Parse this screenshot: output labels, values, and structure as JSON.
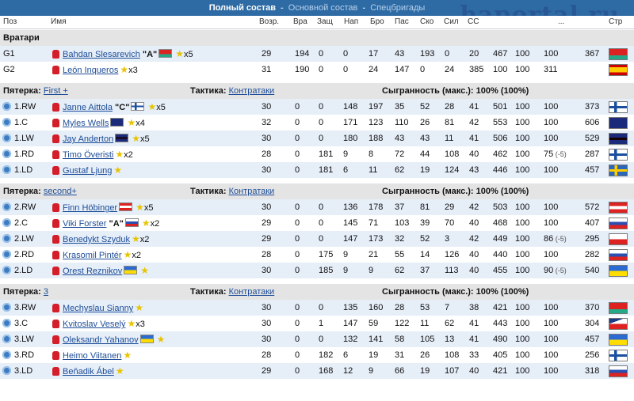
{
  "topbar": {
    "active": "Полный состав",
    "tab2": "Основной состав",
    "tab3": "Спецбригады"
  },
  "watermark": "haportal.ru",
  "header": {
    "pos": "Поз",
    "name": "Имя",
    "age": "Возр.",
    "vra": "Вра",
    "zash": "Защ",
    "nap": "Нап",
    "bro": "Бро",
    "pas": "Пас",
    "sko": "Ско",
    "sil": "Сил",
    "so": "СС",
    "cols_hidden": "...",
    "cr": "Стр"
  },
  "goalies": {
    "title": "Вратари",
    "players": [
      {
        "pos": "G1",
        "name": "Bahdan Slesarevich",
        "tag": "\"A\"",
        "flag": "by",
        "stars": "x5",
        "v": [
          "29",
          "194",
          "0",
          "0",
          "17",
          "43",
          "193",
          "0",
          "20",
          "467",
          "100",
          "100",
          "367"
        ]
      },
      {
        "pos": "G2",
        "name": "León Inqueros",
        "tag": "",
        "flag": "",
        "stars": "x3",
        "v": [
          "31",
          "190",
          "0",
          "0",
          "24",
          "147",
          "0",
          "24",
          "385",
          "100",
          "100",
          "311"
        ],
        "cflag": "es"
      }
    ]
  },
  "lines": [
    {
      "label": "Пятерка:",
      "line_name": "First +",
      "tactic_label": "Тактика:",
      "tactic": "Контратаки",
      "played": "Сыгранность (макс.): 100% (100%)",
      "players": [
        {
          "pos": "1.RW",
          "name": "Janne Aittola",
          "tag": "\"C\"",
          "flag": "fi",
          "stars": "x5",
          "v": [
            "30",
            "0",
            "0",
            "148",
            "197",
            "35",
            "52",
            "28",
            "41",
            "501",
            "100",
            "100",
            "373"
          ],
          "cflag": "fi"
        },
        {
          "pos": "1.C",
          "name": "Myles Wells",
          "tag": "",
          "flag": "au",
          "stars": "x4",
          "v": [
            "32",
            "0",
            "0",
            "171",
            "123",
            "110",
            "26",
            "81",
            "42",
            "553",
            "100",
            "100",
            "606"
          ],
          "cflag": "au"
        },
        {
          "pos": "1.LW",
          "name": "Jay Anderton",
          "tag": "",
          "flag": "gb",
          "stars": "x5",
          "v": [
            "30",
            "0",
            "0",
            "180",
            "188",
            "43",
            "43",
            "11",
            "41",
            "506",
            "100",
            "100",
            "529"
          ],
          "cflag": "gb"
        },
        {
          "pos": "1.RD",
          "name": "Timo Överisti",
          "tag": "",
          "flag": "",
          "stars": "x2",
          "v": [
            "28",
            "0",
            "181",
            "9",
            "8",
            "72",
            "44",
            "108",
            "40",
            "462",
            "100",
            "75",
            "287"
          ],
          "neg": "(-5)",
          "cflag": "fi"
        },
        {
          "pos": "1.LD",
          "name": "Gustaf Ljung",
          "tag": "",
          "flag": "",
          "stars": "",
          "v": [
            "30",
            "0",
            "181",
            "6",
            "11",
            "62",
            "19",
            "124",
            "43",
            "446",
            "100",
            "100",
            "457"
          ],
          "cflag": "se"
        }
      ]
    },
    {
      "label": "Пятерка:",
      "line_name": "second+",
      "tactic_label": "Тактика:",
      "tactic": "Контратаки",
      "played": "Сыгранность (макс.): 100% (100%)",
      "players": [
        {
          "pos": "2.RW",
          "name": "Finn Höbinger",
          "tag": "",
          "flag": "at",
          "stars": "x5",
          "v": [
            "30",
            "0",
            "0",
            "136",
            "178",
            "37",
            "81",
            "29",
            "42",
            "503",
            "100",
            "100",
            "572"
          ],
          "cflag": "at"
        },
        {
          "pos": "2.C",
          "name": "Viki Forster",
          "tag": "\"A\"",
          "flag": "ru",
          "stars": "x2",
          "v": [
            "29",
            "0",
            "0",
            "145",
            "71",
            "103",
            "39",
            "70",
            "40",
            "468",
            "100",
            "100",
            "407"
          ],
          "cflag": "ru"
        },
        {
          "pos": "2.LW",
          "name": "Benedykt Szyduk",
          "tag": "",
          "flag": "",
          "stars": "x2",
          "v": [
            "29",
            "0",
            "0",
            "147",
            "173",
            "32",
            "52",
            "3",
            "42",
            "449",
            "100",
            "86",
            "295"
          ],
          "neg": "(-5)",
          "cflag": "pl"
        },
        {
          "pos": "2.RD",
          "name": "Krasomil Pintér",
          "tag": "",
          "flag": "",
          "stars": "x2",
          "v": [
            "28",
            "0",
            "175",
            "9",
            "21",
            "55",
            "14",
            "126",
            "40",
            "440",
            "100",
            "100",
            "282"
          ],
          "cflag": "sk"
        },
        {
          "pos": "2.LD",
          "name": "Orest Reznikov",
          "tag": "",
          "flag": "ua",
          "stars": "",
          "v": [
            "30",
            "0",
            "185",
            "9",
            "9",
            "62",
            "37",
            "113",
            "40",
            "455",
            "100",
            "90",
            "540"
          ],
          "neg": "(-5)",
          "cflag": "ua"
        }
      ]
    },
    {
      "label": "Пятерка:",
      "line_name": "3",
      "tactic_label": "Тактика:",
      "tactic": "Контратаки",
      "played": "Сыгранность (макс.): 100% (100%)",
      "players": [
        {
          "pos": "3.RW",
          "name": "Mechyslau Sianny",
          "tag": "",
          "flag": "",
          "stars": "",
          "v": [
            "30",
            "0",
            "0",
            "135",
            "160",
            "28",
            "53",
            "7",
            "38",
            "421",
            "100",
            "100",
            "370"
          ],
          "cflag": "by"
        },
        {
          "pos": "3.C",
          "name": "Kvitoslav Veselý",
          "tag": "",
          "flag": "",
          "stars": "x3",
          "v": [
            "30",
            "0",
            "1",
            "147",
            "59",
            "122",
            "11",
            "62",
            "41",
            "443",
            "100",
            "100",
            "304"
          ],
          "cflag": "cz"
        },
        {
          "pos": "3.LW",
          "name": "Oleksandr Yahanov",
          "tag": "",
          "flag": "ua",
          "stars": "",
          "v": [
            "30",
            "0",
            "0",
            "132",
            "141",
            "58",
            "105",
            "13",
            "41",
            "490",
            "100",
            "100",
            "457"
          ],
          "cflag": "ua"
        },
        {
          "pos": "3.RD",
          "name": "Heimo Viitanen",
          "tag": "",
          "flag": "",
          "stars": "",
          "v": [
            "28",
            "0",
            "182",
            "6",
            "19",
            "31",
            "26",
            "108",
            "33",
            "405",
            "100",
            "100",
            "256"
          ],
          "cflag": "fi"
        },
        {
          "pos": "3.LD",
          "name": "Beňadik Ábel",
          "tag": "",
          "flag": "",
          "stars": "",
          "v": [
            "29",
            "0",
            "168",
            "12",
            "9",
            "66",
            "19",
            "107",
            "40",
            "421",
            "100",
            "100",
            "318"
          ],
          "cflag": "sk"
        }
      ]
    }
  ]
}
